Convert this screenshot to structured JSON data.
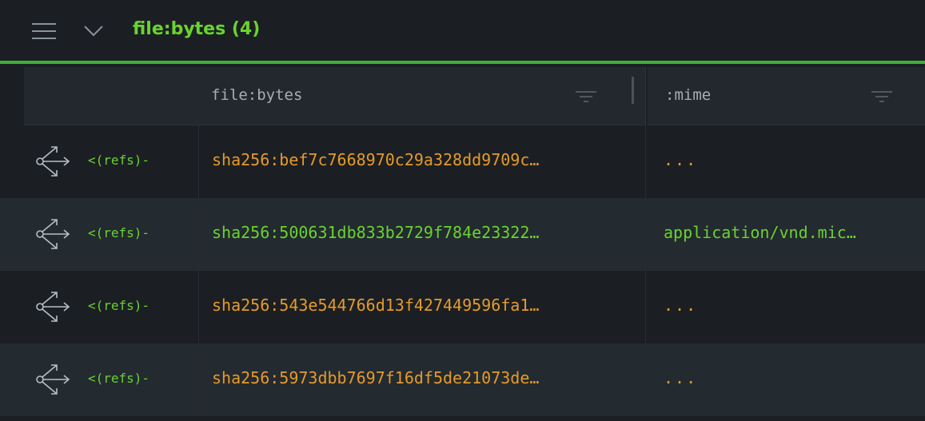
{
  "header": {
    "title": "file:bytes (4)"
  },
  "columns": {
    "bytes": {
      "label": "file:bytes"
    },
    "mime": {
      "label": ":mime"
    }
  },
  "rows": [
    {
      "refs": "<(refs)-",
      "bytes": "sha256:bef7c7668970c29a328dd9709c…",
      "mime": "...",
      "bytes_color": "#e69a2b",
      "mime_color": "#e69a2b"
    },
    {
      "refs": "<(refs)-",
      "bytes": "sha256:500631db833b2729f784e23322…",
      "mime": "application/vnd.mic…",
      "bytes_color": "#6ad32f",
      "mime_color": "#6ad32f"
    },
    {
      "refs": "<(refs)-",
      "bytes": "sha256:543e544766d13f427449596fa1…",
      "mime": "...",
      "bytes_color": "#e69a2b",
      "mime_color": "#e69a2b"
    },
    {
      "refs": "<(refs)-",
      "bytes": "sha256:5973dbb7697f16df5de21073de…",
      "mime": "...",
      "bytes_color": "#e69a2b",
      "mime_color": "#e69a2b"
    }
  ],
  "icons": {
    "menu": "hamburger-icon",
    "collapse": "chevron-down-icon",
    "filter": "filter-icon",
    "pivot": "share-icon"
  },
  "colors": {
    "accent": "#3fb037",
    "title": "#6ad32f",
    "unknown_value": "#e69a2b",
    "known_value": "#6ad32f"
  }
}
